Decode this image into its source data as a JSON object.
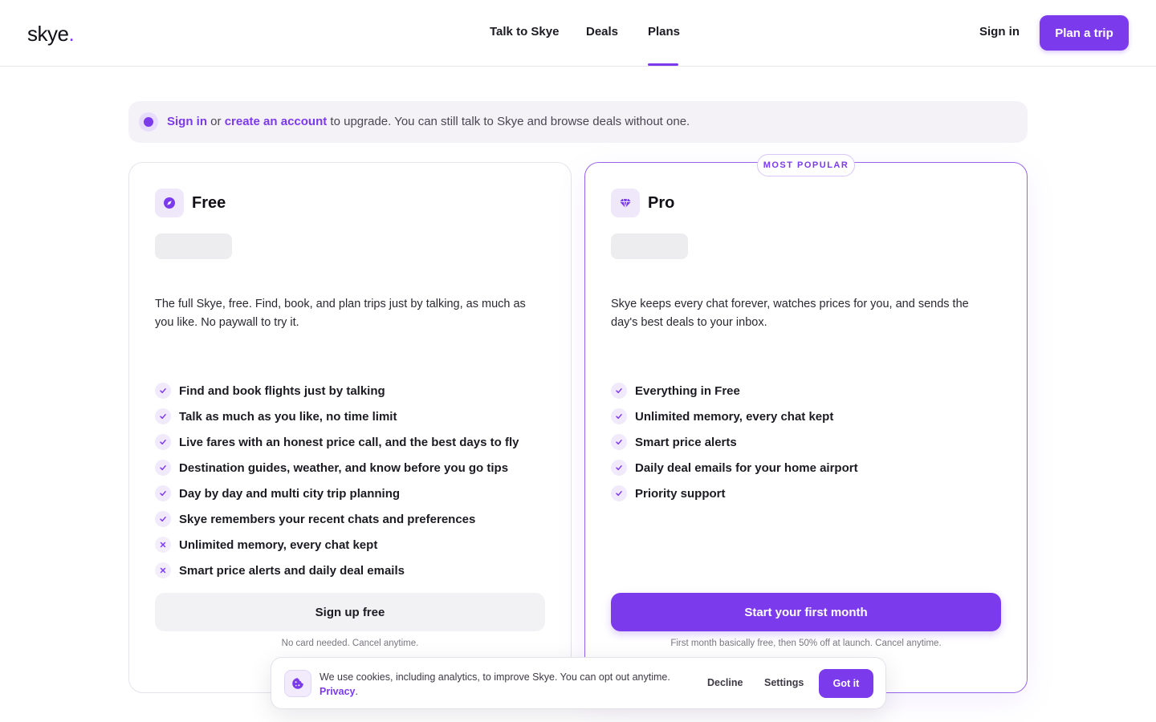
{
  "colors": {
    "accent": "#7c3aed",
    "muted_bg": "#f4f2f7",
    "text": "#1c1a22"
  },
  "header": {
    "logo_text": "skye",
    "logo_dot": ".",
    "nav": [
      {
        "label": "Talk to Skye",
        "active": false
      },
      {
        "label": "Deals",
        "active": false
      },
      {
        "label": "Plans",
        "active": true
      }
    ],
    "sign_in": "Sign in",
    "cta": "Plan a trip"
  },
  "banner": {
    "icon": "dot-icon",
    "sign_in": "Sign in",
    "or": "or",
    "create_account": "create an account",
    "rest": "to upgrade. You can still talk to Skye and browse deals without one."
  },
  "plans": {
    "free": {
      "icon": "compass-icon",
      "name": "Free",
      "description": "The full Skye, free. Find, book, and plan trips just by talking, as much as you like. No paywall to try it.",
      "features": [
        {
          "label": "Find and book flights just by talking",
          "included": true
        },
        {
          "label": "Talk as much as you like, no time limit",
          "included": true
        },
        {
          "label": "Live fares with an honest price call, and the best days to fly",
          "included": true
        },
        {
          "label": "Destination guides, weather, and know before you go tips",
          "included": true
        },
        {
          "label": "Day by day and multi city trip planning",
          "included": true
        },
        {
          "label": "Skye remembers your recent chats and preferences",
          "included": true
        },
        {
          "label": "Unlimited memory, every chat kept",
          "included": false
        },
        {
          "label": "Smart price alerts and daily deal emails",
          "included": false
        }
      ],
      "cta": "Sign up free",
      "fineprint": "No card needed. Cancel anytime."
    },
    "pro": {
      "badge": "MOST POPULAR",
      "icon": "gem-icon",
      "name": "Pro",
      "description": "Skye keeps every chat forever, watches prices for you, and sends the day's best deals to your inbox.",
      "features": [
        {
          "label": "Everything in Free",
          "included": true
        },
        {
          "label": "Unlimited memory, every chat kept",
          "included": true
        },
        {
          "label": "Smart price alerts",
          "included": true
        },
        {
          "label": "Daily deal emails for your home airport",
          "included": true
        },
        {
          "label": "Priority support",
          "included": true
        }
      ],
      "cta": "Start your first month",
      "fineprint": "First month basically free, then 50% off at launch. Cancel anytime."
    }
  },
  "cookie": {
    "icon": "cookie-icon",
    "text": "We use cookies, including analytics, to improve Skye. You can opt out anytime.",
    "privacy": "Privacy",
    "period": ".",
    "decline": "Decline",
    "settings": "Settings",
    "accept": "Got it"
  }
}
